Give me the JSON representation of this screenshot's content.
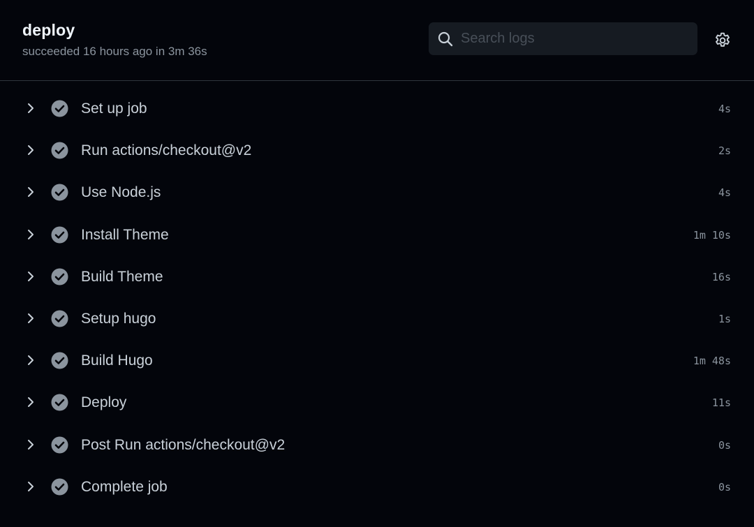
{
  "job": {
    "title": "deploy",
    "status": "succeeded 16 hours ago in 3m 36s"
  },
  "search": {
    "placeholder": "Search logs",
    "value": ""
  },
  "icons": {
    "search": "search-icon",
    "settings": "gear-icon",
    "expand": "chevron-right-icon",
    "status": "check-circle-icon"
  },
  "colors": {
    "background": "#03050b",
    "check": "#8b949e",
    "text": "#c9d1d9",
    "muted": "#8b949e"
  },
  "steps": [
    {
      "name": "Set up job",
      "duration": "4s",
      "status": "success"
    },
    {
      "name": "Run actions/checkout@v2",
      "duration": "2s",
      "status": "success"
    },
    {
      "name": "Use Node.js",
      "duration": "4s",
      "status": "success"
    },
    {
      "name": "Install Theme",
      "duration": "1m 10s",
      "status": "success"
    },
    {
      "name": "Build Theme",
      "duration": "16s",
      "status": "success"
    },
    {
      "name": "Setup hugo",
      "duration": "1s",
      "status": "success"
    },
    {
      "name": "Build Hugo",
      "duration": "1m 48s",
      "status": "success"
    },
    {
      "name": "Deploy",
      "duration": "11s",
      "status": "success"
    },
    {
      "name": "Post Run actions/checkout@v2",
      "duration": "0s",
      "status": "success"
    },
    {
      "name": "Complete job",
      "duration": "0s",
      "status": "success"
    }
  ]
}
